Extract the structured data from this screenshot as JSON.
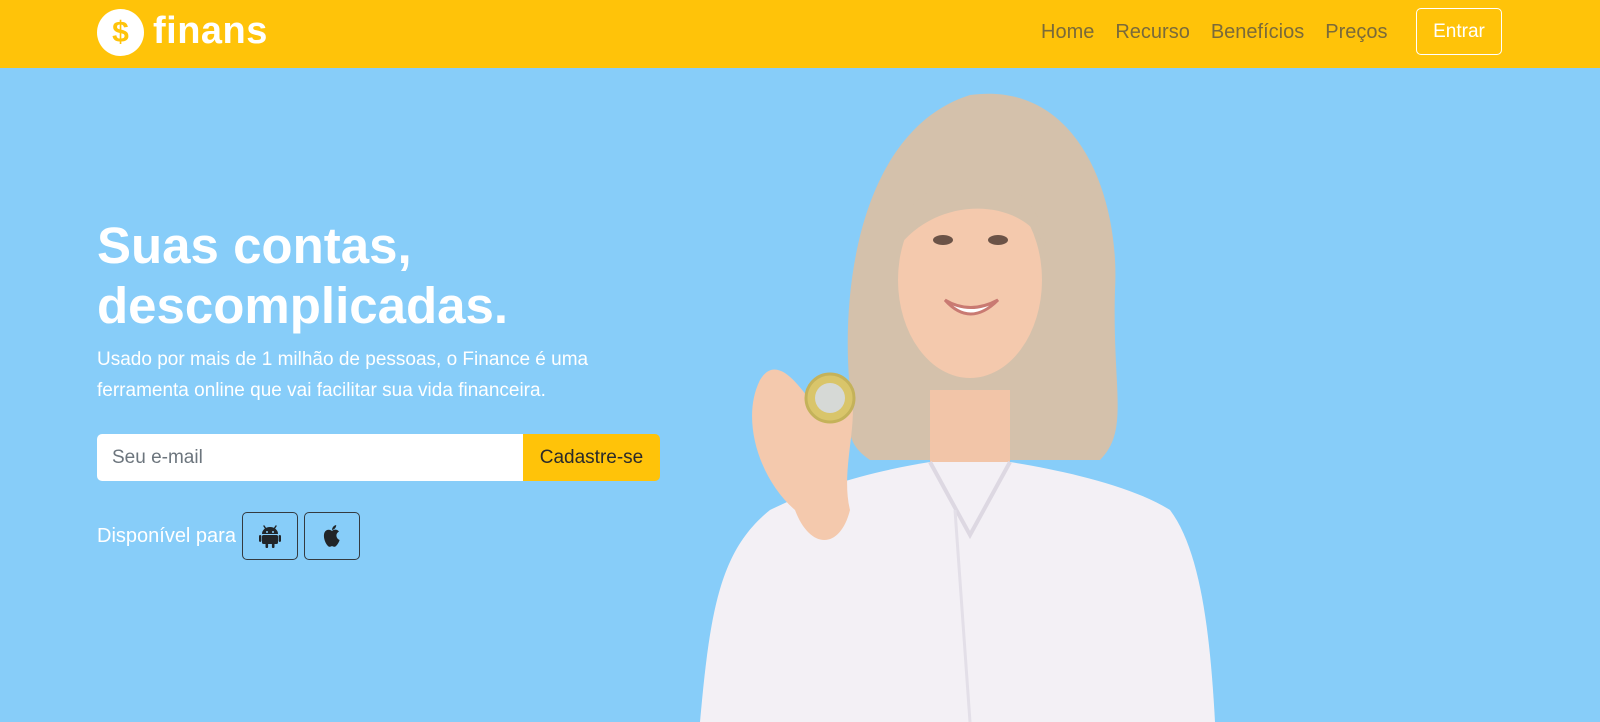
{
  "brand": {
    "name": "finans",
    "coin_symbol": "$",
    "logo_icon": "dollar-coin-icon"
  },
  "nav": {
    "links": [
      "Home",
      "Recurso",
      "Benefícios",
      "Preços"
    ],
    "login_label": "Entrar"
  },
  "hero": {
    "title_line1": "Suas contas,",
    "title_line2": "descomplicadas.",
    "subtitle_line1": "Usado por mais de 1 milhão de pessoas, o Finance é uma",
    "subtitle_line2": "ferramenta online que vai facilitar sua vida financeira.",
    "email_placeholder": "Seu e-mail",
    "signup_label": "Cadastre-se",
    "available_label": "Disponível para",
    "platform_icons": [
      "android-icon",
      "apple-icon"
    ]
  },
  "colors": {
    "navbar": "#ffc309",
    "hero_background": "#87cdf9",
    "accent": "#ffc309",
    "nav_link": "#7a6a3a",
    "text_light": "#ffffff"
  }
}
